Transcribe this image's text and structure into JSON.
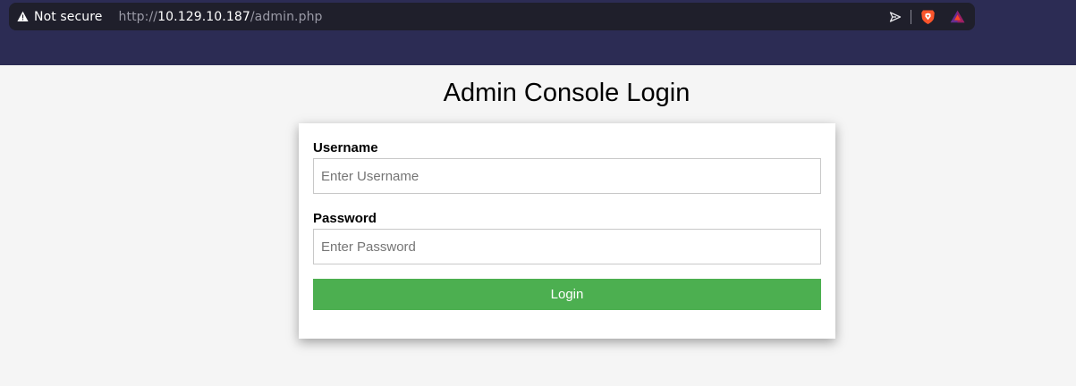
{
  "browser": {
    "security_label": "Not secure",
    "url": {
      "scheme": "http://",
      "host": "10.129.10.187",
      "path": "/admin.php"
    },
    "icons": {
      "security": "warning-triangle-icon",
      "share": "share-icon",
      "shields": "brave-shields-icon",
      "rewards": "brave-rewards-icon"
    },
    "colors": {
      "toolbar": "#2c2c54",
      "omnibox": "#1f1f2b"
    }
  },
  "page": {
    "title": "Admin Console Login",
    "form": {
      "username_label": "Username",
      "username_placeholder": "Enter Username",
      "username_value": "",
      "password_label": "Password",
      "password_placeholder": "Enter Password",
      "password_value": "",
      "submit_label": "Login"
    },
    "colors": {
      "background": "#f5f5f5",
      "button": "#4caf50"
    }
  }
}
